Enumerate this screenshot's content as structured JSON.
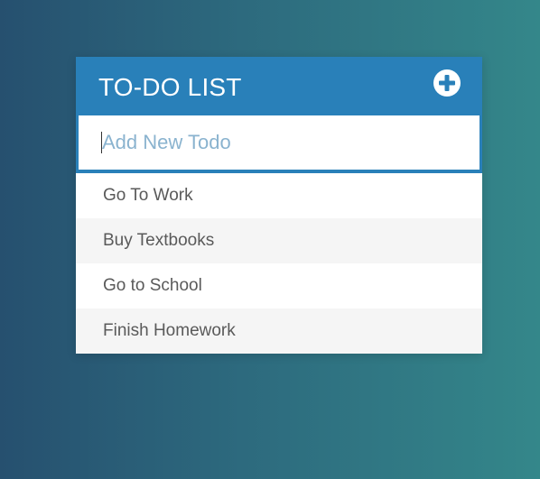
{
  "header": {
    "title": "TO-DO LIST",
    "add_icon": "plus-circle-icon"
  },
  "input": {
    "value": "",
    "placeholder": "Add New Todo"
  },
  "todos": [
    {
      "label": "Go To Work"
    },
    {
      "label": "Buy Textbooks"
    },
    {
      "label": "Go to School"
    },
    {
      "label": "Finish Homework"
    }
  ],
  "colors": {
    "accent": "#2980b9",
    "item_text": "#5a5a5a",
    "alt_row": "#f5f5f5",
    "placeholder": "#8ab3cf"
  }
}
